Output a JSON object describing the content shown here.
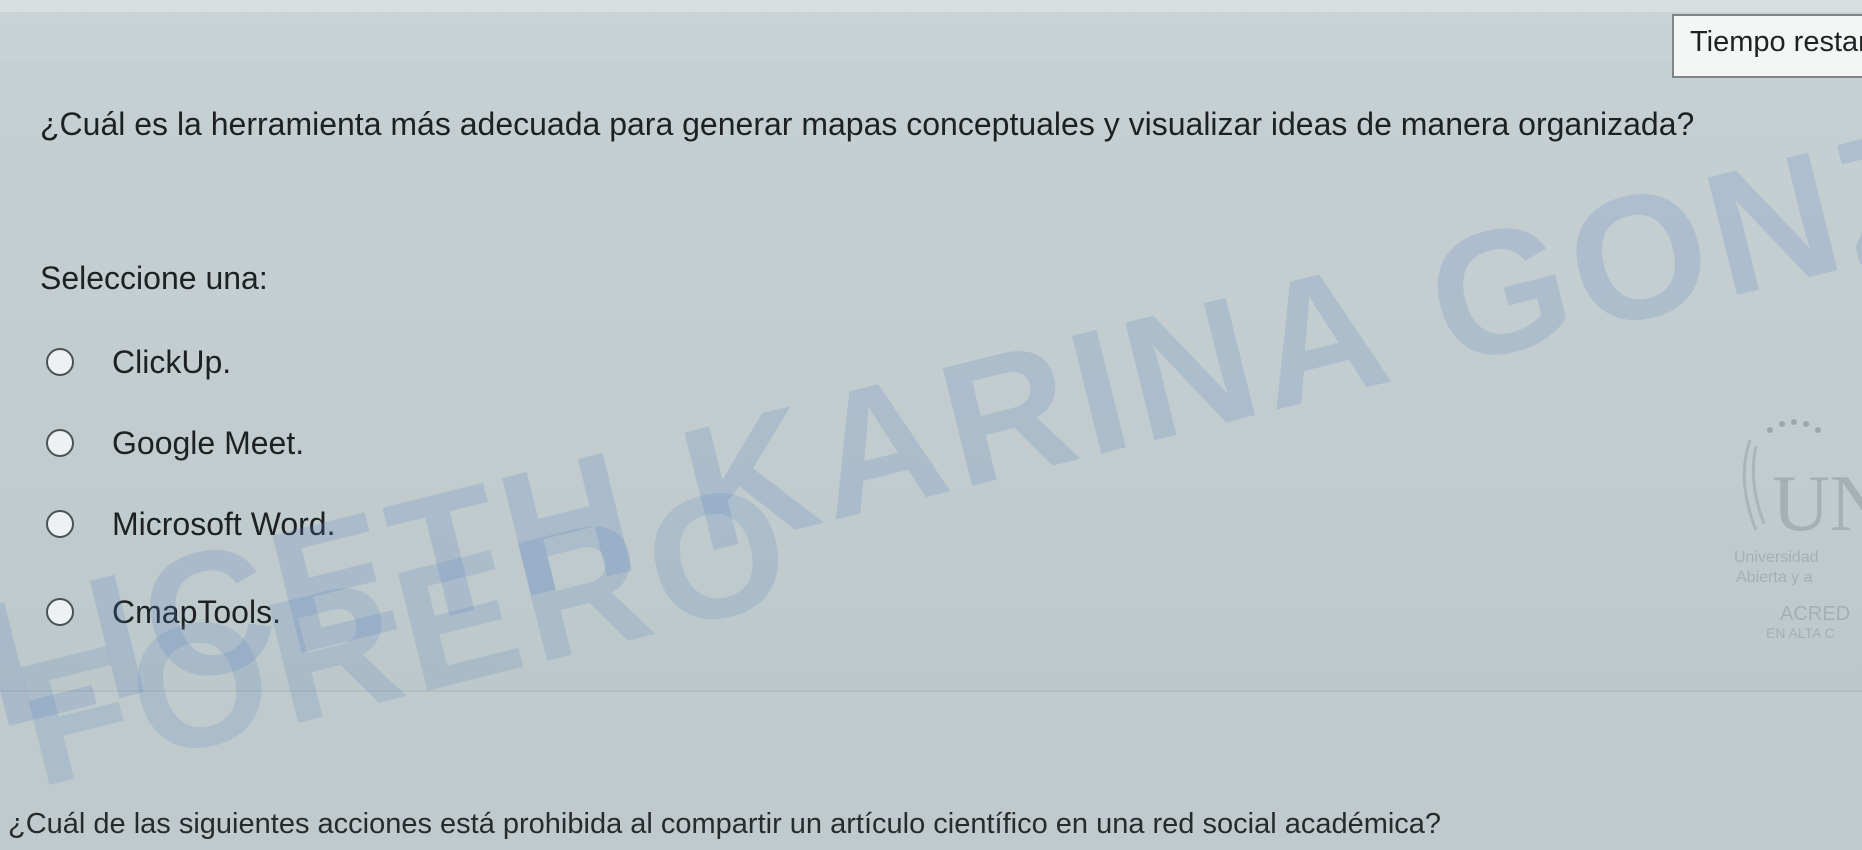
{
  "timer": {
    "label": "Tiempo restar"
  },
  "question": {
    "text": "¿Cuál es la herramienta más adecuada para generar mapas conceptuales y visualizar ideas de manera organizada?",
    "select_prompt": "Seleccione una:",
    "options": [
      {
        "label": "ClickUp."
      },
      {
        "label": "Google Meet."
      },
      {
        "label": "Microsoft Word."
      },
      {
        "label": "CmapTools."
      }
    ]
  },
  "next_question": {
    "text": "¿Cuál de las siguientes acciones está prohibida al compartir un artículo científico en una red social académica?"
  },
  "watermark": {
    "line1": "LICETH KARINA GONZALEZ",
    "line2": "FORERO"
  },
  "logo": {
    "letters": "UN",
    "word1": "Universidad",
    "word2": "Abierta y a",
    "word3": "ACRED",
    "word4": "EN ALTA C"
  },
  "colors": {
    "background": "#c4ced0",
    "watermark": "#5a86c2",
    "text": "#1d2124"
  }
}
